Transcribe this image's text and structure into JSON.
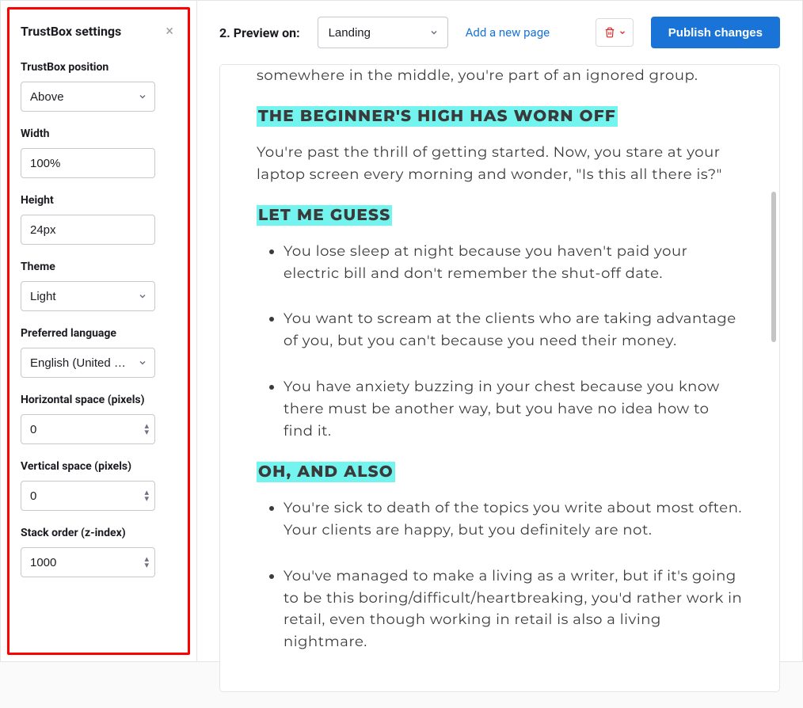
{
  "sidebar": {
    "title": "TrustBox settings",
    "fields": {
      "position": {
        "label": "TrustBox position",
        "value": "Above"
      },
      "width": {
        "label": "Width",
        "value": "100%"
      },
      "height": {
        "label": "Height",
        "value": "24px"
      },
      "theme": {
        "label": "Theme",
        "value": "Light"
      },
      "language": {
        "label": "Preferred language",
        "value": "English (United Sta…"
      },
      "hspace": {
        "label": "Horizontal space (pixels)",
        "value": "0"
      },
      "vspace": {
        "label": "Vertical space (pixels)",
        "value": "0"
      },
      "zindex": {
        "label": "Stack order (z-index)",
        "value": "1000"
      }
    }
  },
  "topbar": {
    "preview_label": "2. Preview on:",
    "preview_select_value": "Landing",
    "add_page_label": "Add a new page",
    "publish_label": "Publish changes"
  },
  "content": {
    "intro_tail": "somewhere in the middle, you're part of an ignored group.",
    "h1": "THE BEGINNER'S HIGH HAS WORN OFF",
    "p1": "You're past the thrill of getting started. Now, you stare at your laptop screen every morning and wonder, \"Is this all there is?\"",
    "h2": "LET ME GUESS",
    "l1": "You lose sleep at night because you haven't paid your electric bill and don't remember the shut-off date.",
    "l2": "You want to scream at the clients who are taking advantage of you, but you can't because you need their money.",
    "l3": "You have anxiety buzzing in your chest because you know there must be another way, but you have no idea how to find it.",
    "h3": "OH, AND ALSO",
    "l4": "You're sick to death of the topics you write about most often. Your clients are happy, but you definitely are not.",
    "l5": "You've managed to make a living as a writer, but if it's going to be this boring/difficult/heartbreaking, you'd rather work in retail, even though working in retail is also a living nightmare."
  }
}
